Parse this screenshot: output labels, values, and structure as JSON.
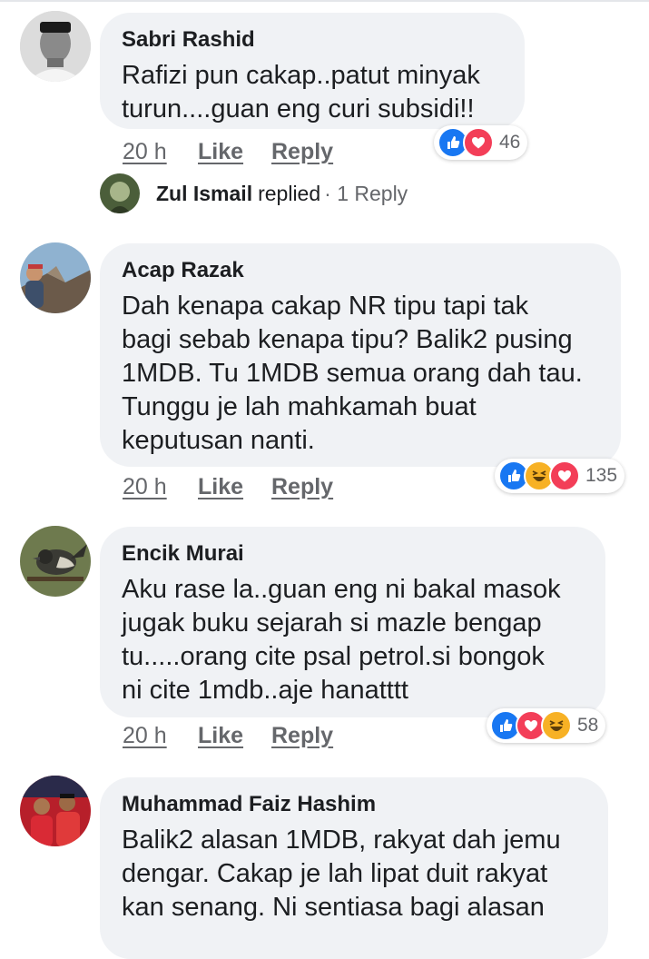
{
  "comments": [
    {
      "author": "Sabri Rashid",
      "text": "Rafizi pun cakap..patut minyak\nturun....guan eng curi subsidi!!",
      "time": "20 h",
      "like_label": "Like",
      "reply_label": "Reply",
      "reactions": [
        "like-icon",
        "love-icon"
      ],
      "reaction_count": "46"
    },
    {
      "author": "Acap Razak",
      "text": "Dah kenapa cakap NR tipu tapi tak\nbagi sebab kenapa tipu? Balik2 pusing\n1MDB. Tu 1MDB semua orang dah tau.\nTunggu je lah mahkamah buat\nkeputusan nanti.",
      "time": "20 h",
      "like_label": "Like",
      "reply_label": "Reply",
      "reactions": [
        "like-icon",
        "haha-icon",
        "love-icon"
      ],
      "reaction_count": "135"
    },
    {
      "author": "Encik Murai",
      "text": "Aku rase la..guan eng ni bakal masok\njugak buku sejarah si mazle  bengap\ntu.....orang cite psal petrol.si bongok\nni cite 1mdb..aje hanatttt",
      "time": "20 h",
      "like_label": "Like",
      "reply_label": "Reply",
      "reactions": [
        "like-icon",
        "love-icon",
        "haha-icon"
      ],
      "reaction_count": "58"
    },
    {
      "author": "Muhammad Faiz Hashim",
      "text": "Balik2  alasan 1MDB, rakyat dah jemu\ndengar. Cakap je lah lipat duit rakyat\nkan senang. Ni sentiasa bagi alasan"
    }
  ],
  "reply_summary": {
    "name": "Zul Ismail",
    "action": "replied",
    "count": "· 1 Reply"
  },
  "colors": {
    "bubble": "#f0f2f5",
    "like": "#1877f2",
    "love": "#f33e58",
    "haha": "#f7b125",
    "meta": "#65676b"
  }
}
